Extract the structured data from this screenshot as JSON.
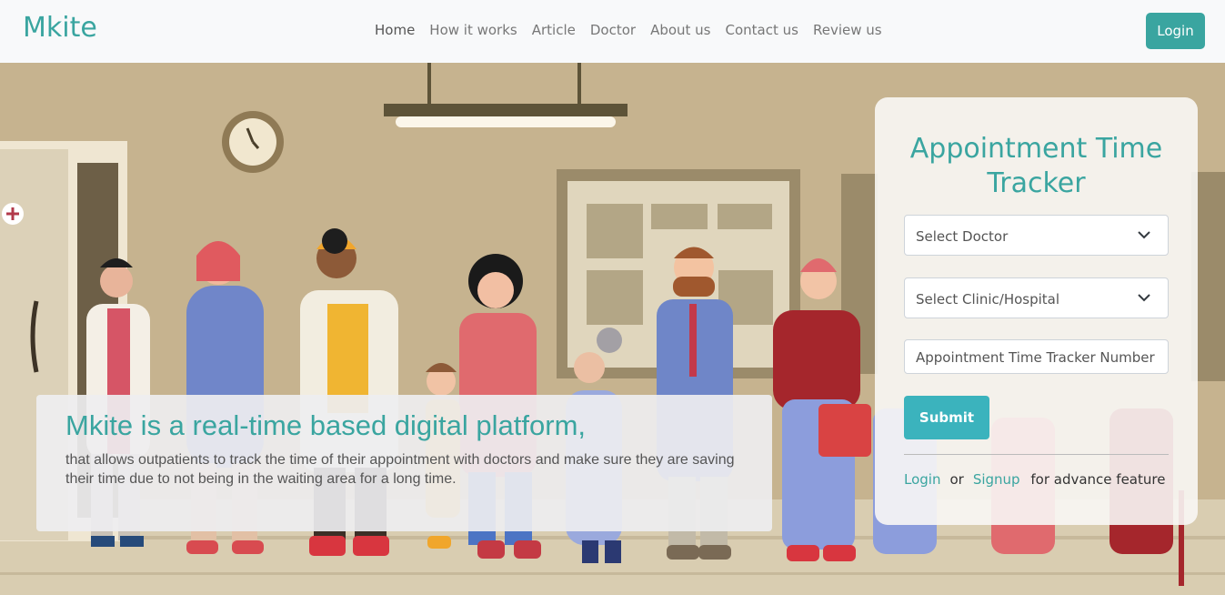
{
  "brand": "Mkite",
  "nav": {
    "items": [
      "Home",
      "How it works",
      "Article",
      "Doctor",
      "About us",
      "Contact us",
      "Review us"
    ],
    "login": "Login"
  },
  "hero": {
    "title": "Mkite is a real-time based digital platform,",
    "text": "that allows outpatients to track the time of their appointment with doctors and make sure they are saving their time due to not being in the waiting area for a long time."
  },
  "tracker": {
    "title": "Appointment Time Tracker",
    "doctor_select": "Select Doctor",
    "clinic_select": "Select Clinic/Hospital",
    "number_placeholder": "Appointment Time Tracker Number",
    "submit": "Submit",
    "footer_login": "Login",
    "footer_or": "or",
    "footer_signup": "Signup",
    "footer_suffix": "for advance feature"
  },
  "colors": {
    "accent": "#3aa5a0",
    "submit": "#3bb3bd",
    "wall": "#c8b591"
  }
}
